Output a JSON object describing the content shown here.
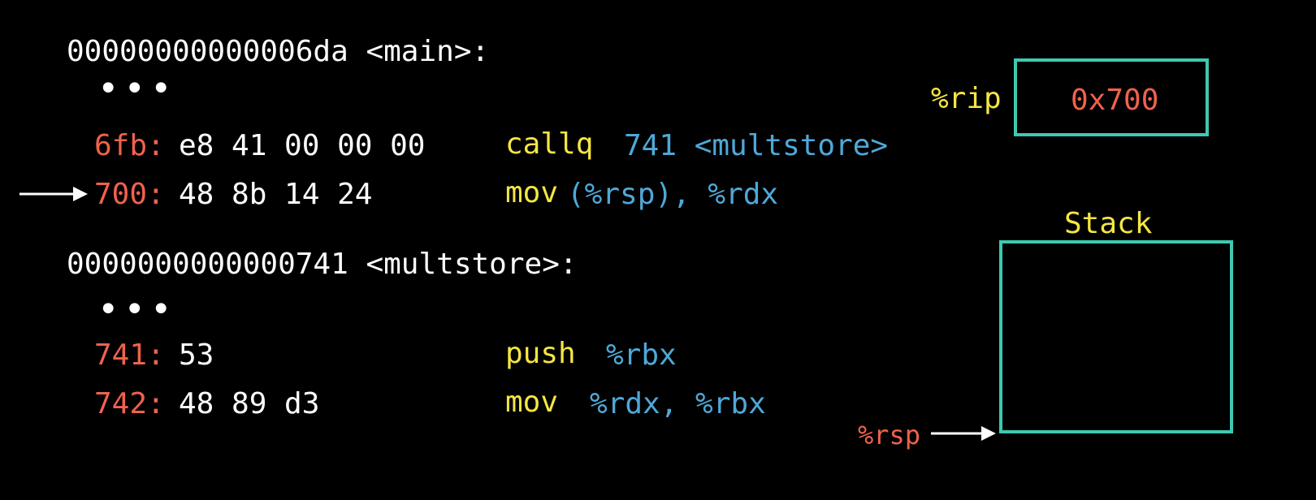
{
  "main_section": {
    "header": "00000000000006da <main>:",
    "ellipsis": "•••",
    "lines": [
      {
        "addr": "6fb:",
        "bytes": "e8 41 00 00 00",
        "op": "callq",
        "args": "741 <multstore>"
      },
      {
        "addr": "700:",
        "bytes": "48 8b 14 24",
        "op": "mov",
        "args": "(%rsp), %rdx"
      }
    ]
  },
  "multstore_section": {
    "header": "0000000000000741 <multstore>:",
    "ellipsis": "•••",
    "lines": [
      {
        "addr": "741:",
        "bytes": "53",
        "op": "push",
        "args": "%rbx"
      },
      {
        "addr": "742:",
        "bytes": "48 89 d3",
        "op": "mov",
        "args": "%rdx, %rbx"
      }
    ]
  },
  "rip_register": {
    "label": "%rip",
    "value": "0x700"
  },
  "stack": {
    "title": "Stack",
    "pointer_label": "%rsp"
  },
  "colors": {
    "background": "#000000",
    "address": "#f0624d",
    "opcode": "#f5e642",
    "operand": "#4fa8d8",
    "box_border": "#3ec9b0",
    "text": "#ffffff"
  },
  "icons": {
    "current_instruction_marker": "right-arrow-icon",
    "stack_pointer_marker": "right-arrow-icon"
  }
}
